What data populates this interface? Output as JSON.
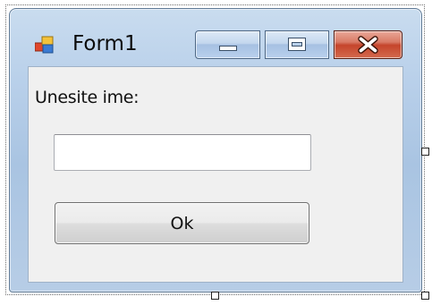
{
  "window": {
    "title": "Form1",
    "icon": "form-app-icon",
    "caption_buttons": [
      {
        "name": "minimize",
        "icon": "minimize-icon"
      },
      {
        "name": "maximize",
        "icon": "maximize-icon"
      },
      {
        "name": "close",
        "icon": "close-icon"
      }
    ]
  },
  "form": {
    "label_text": "Unesite ime:",
    "name_input": {
      "value": "",
      "placeholder": ""
    },
    "ok_button_label": "Ok"
  },
  "colors": {
    "frame": "#b9d0ea",
    "client_background": "#f0f0f0",
    "close_button": "#c5452c"
  }
}
